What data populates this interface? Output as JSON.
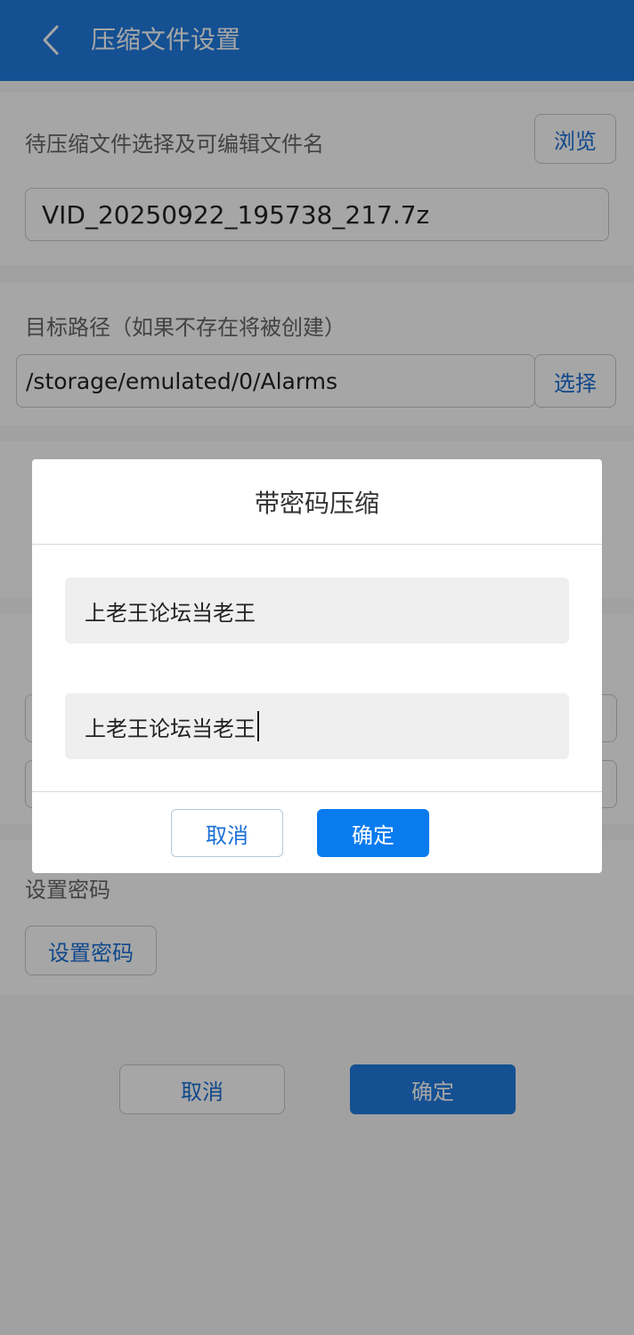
{
  "appbar": {
    "title": "压缩文件设置"
  },
  "source": {
    "label": "待压缩文件选择及可编辑文件名",
    "browse_label": "浏览",
    "filename": "VID_20250922_195738_217.7z"
  },
  "target": {
    "label": "目标路径（如果不存在将被创建）",
    "path": "/storage/emulated/0/Alarms",
    "select_label": "选择"
  },
  "password_section": {
    "label": "设置密码",
    "button_label": "设置密码"
  },
  "footer": {
    "cancel_label": "取消",
    "confirm_label": "确定"
  },
  "dialog": {
    "title": "带密码压缩",
    "password": "上老王论坛当老王",
    "confirm_password": "上老王论坛当老王",
    "cancel_label": "取消",
    "confirm_label": "确定"
  },
  "colors": {
    "primary": "#1f7ce0",
    "link": "#1a6fd6"
  }
}
